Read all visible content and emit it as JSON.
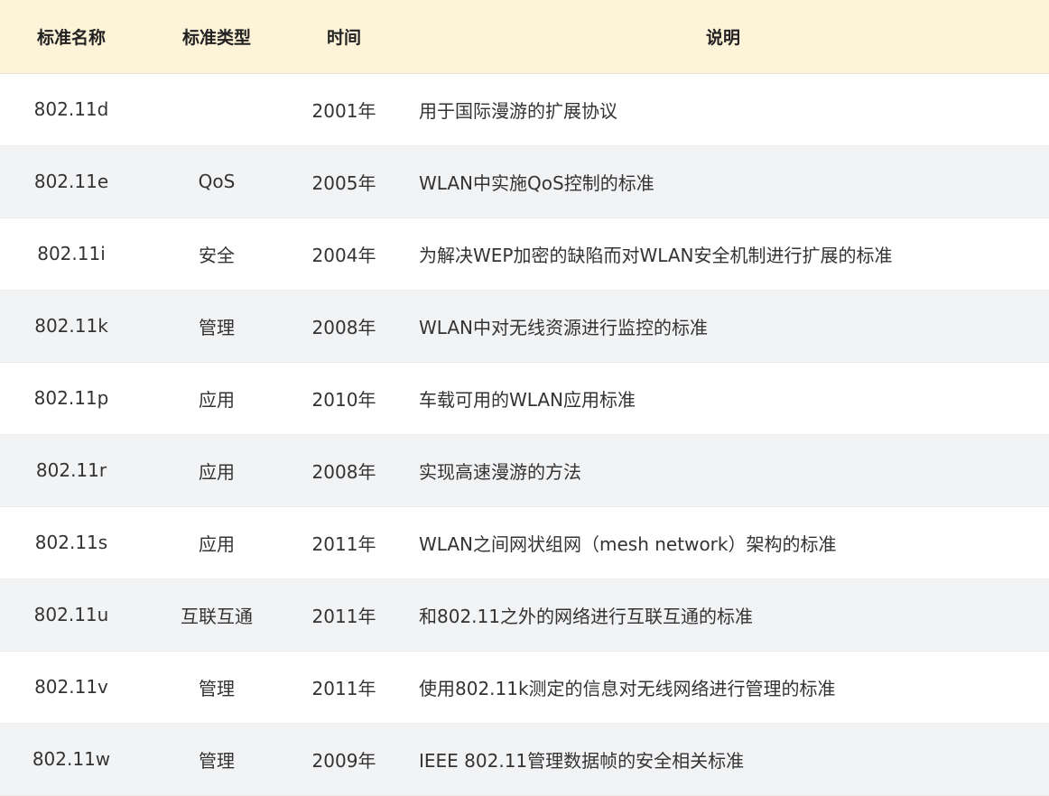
{
  "table": {
    "headers": {
      "name": "标准名称",
      "type": "标准类型",
      "time": "时间",
      "desc": "说明"
    },
    "rows": [
      {
        "name": "802.11d",
        "type": "",
        "time": "2001年",
        "desc": "用于国际漫游的扩展协议"
      },
      {
        "name": "802.11e",
        "type": "QoS",
        "time": "2005年",
        "desc": "WLAN中实施QoS控制的标准"
      },
      {
        "name": "802.11i",
        "type": "安全",
        "time": "2004年",
        "desc": "为解决WEP加密的缺陷而对WLAN安全机制进行扩展的标准"
      },
      {
        "name": "802.11k",
        "type": "管理",
        "time": "2008年",
        "desc": "WLAN中对无线资源进行监控的标准"
      },
      {
        "name": "802.11p",
        "type": "应用",
        "time": "2010年",
        "desc": "车载可用的WLAN应用标准"
      },
      {
        "name": "802.11r",
        "type": "应用",
        "time": "2008年",
        "desc": "实现高速漫游的方法"
      },
      {
        "name": "802.11s",
        "type": "应用",
        "time": "2011年",
        "desc": "WLAN之间网状组网（mesh network）架构的标准"
      },
      {
        "name": "802.11u",
        "type": "互联互通",
        "time": "2011年",
        "desc": "和802.11之外的网络进行互联互通的标准"
      },
      {
        "name": "802.11v",
        "type": "管理",
        "time": "2011年",
        "desc": "使用802.11k测定的信息对无线网络进行管理的标准"
      },
      {
        "name": "802.11w",
        "type": "管理",
        "time": "2009年",
        "desc": "IEEE 802.11管理数据帧的安全相关标准"
      }
    ]
  },
  "colors": {
    "header_bg": "#fdf3d8",
    "stripe_bg": "#f2f3f5",
    "text": "#333333"
  }
}
